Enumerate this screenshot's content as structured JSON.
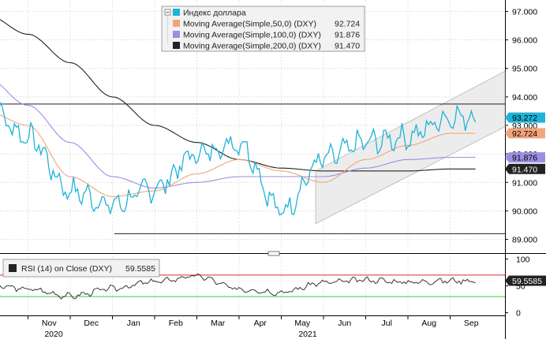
{
  "chart_data": [
    {
      "type": "line",
      "panel": "price",
      "legend": [
        {
          "label": "Индекс доллара",
          "value": "",
          "color": "#1fb3d8",
          "marker": "box"
        },
        {
          "label": "Moving Average(Simple,50,0) (DXY)",
          "value": "92.724",
          "color": "#f0a57c",
          "marker": "box"
        },
        {
          "label": "Moving Average(Simple,100,0) (DXY)",
          "value": "91.876",
          "color": "#9b8fe3",
          "marker": "box"
        },
        {
          "label": "Moving Average(Simple,200,0) (DXY)",
          "value": "91.470",
          "color": "#222222",
          "marker": "box"
        }
      ],
      "y_ticks": [
        "97.000",
        "96.000",
        "95.000",
        "94.000",
        "93.000",
        "92.000",
        "91.000",
        "90.000",
        "89.000"
      ],
      "ylim": [
        88.6,
        97.4
      ],
      "last_value_tags": [
        {
          "text": "93.272",
          "value": 93.272,
          "bg": "#1fb3d8",
          "fg": "#000000"
        },
        {
          "text": "92.724",
          "value": 92.724,
          "bg": "#f0a57c",
          "fg": "#000000"
        },
        {
          "text": "91.876",
          "value": 91.876,
          "bg": "#9b8fe3",
          "fg": "#000000"
        },
        {
          "text": "91.470",
          "value": 91.47,
          "bg": "#222222",
          "fg": "#ffffff"
        }
      ],
      "x": [
        "2020-10",
        "2020-11",
        "2020-12",
        "2021-01",
        "2021-02",
        "2021-03",
        "2021-04",
        "2021-05",
        "2021-06",
        "2021-07",
        "2021-08",
        "2021-09"
      ],
      "series": [
        {
          "name": "Индекс доллара",
          "color": "#1fb3d8",
          "values": [
            93.7,
            92.6,
            90.7,
            90.2,
            90.8,
            92.0,
            92.4,
            90.0,
            91.8,
            92.4,
            92.6,
            93.3
          ]
        },
        {
          "name": "Moving Average(Simple,50,0) (DXY)",
          "color": "#f0a57c",
          "values": [
            93.5,
            93.0,
            91.2,
            90.5,
            90.7,
            91.3,
            91.8,
            91.4,
            91.0,
            91.8,
            92.3,
            92.72
          ]
        },
        {
          "name": "Moving Average(Simple,100,0) (DXY)",
          "color": "#9b8fe3",
          "values": [
            94.7,
            93.7,
            92.4,
            91.2,
            90.8,
            91.0,
            91.2,
            91.2,
            91.2,
            91.5,
            91.8,
            91.88
          ]
        },
        {
          "name": "Moving Average(Simple,200,0) (DXY)",
          "color": "#222222",
          "values": [
            96.9,
            96.2,
            95.2,
            94.0,
            93.0,
            92.4,
            91.8,
            91.5,
            91.4,
            91.4,
            91.4,
            91.47
          ]
        }
      ],
      "reference_lines": [
        {
          "value": 93.75,
          "color": "#000000"
        },
        {
          "value": 89.2,
          "color": "#000000"
        }
      ]
    },
    {
      "type": "line",
      "panel": "rsi",
      "legend": [
        {
          "label": "RSI (14)  on Close (DXY)",
          "value": "59.5585",
          "color": "#222222",
          "marker": "box"
        }
      ],
      "y_ticks": [
        "100",
        "50",
        "0"
      ],
      "ylim": [
        -5,
        105
      ],
      "last_value_tags": [
        {
          "text": "59.5585",
          "value": 59.5585,
          "bg": "#222222",
          "fg": "#ffffff"
        }
      ],
      "x": [
        "2020-10",
        "2020-11",
        "2020-12",
        "2021-01",
        "2021-02",
        "2021-03",
        "2021-04",
        "2021-05",
        "2021-06",
        "2021-07",
        "2021-08",
        "2021-09"
      ],
      "series": [
        {
          "name": "RSI (14)  on Close (DXY)",
          "color": "#222222",
          "values": [
            52,
            44,
            31,
            45,
            58,
            68,
            44,
            38,
            56,
            61,
            57,
            59.56
          ]
        }
      ],
      "reference_lines": [
        {
          "value": 70,
          "color": "#e0282e"
        },
        {
          "value": 30,
          "color": "#3cc83c"
        }
      ]
    }
  ],
  "x_axis": {
    "months": [
      "Nov",
      "Dec",
      "Jan",
      "Feb",
      "Mar",
      "Apr",
      "May",
      "Jun",
      "Jul",
      "Aug",
      "Sep"
    ],
    "years": [
      "2020",
      "2021"
    ]
  }
}
